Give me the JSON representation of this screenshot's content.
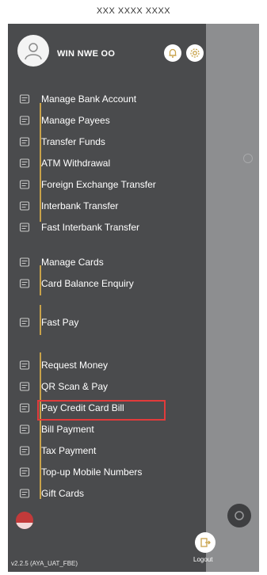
{
  "top_caption": "XXX XXXX XXXX",
  "user": {
    "name": "WIN NWE OO"
  },
  "menu": {
    "items": [
      {
        "label": "Manage Bank Account",
        "icon": "bank-icon"
      },
      {
        "label": "Manage Payees",
        "icon": "payees-icon"
      },
      {
        "label": "Transfer Funds",
        "icon": "transfer-icon"
      },
      {
        "label": "ATM Withdrawal",
        "icon": "atm-icon"
      },
      {
        "label": "Foreign Exchange Transfer",
        "icon": "transfer-icon"
      },
      {
        "label": "Interbank Transfer",
        "icon": "transfer-icon"
      },
      {
        "label": "Fast Interbank Transfer",
        "icon": "transfer-icon"
      },
      {
        "label": "Manage Cards",
        "icon": "card-icon"
      },
      {
        "label": "Card Balance Enquiry",
        "icon": "card-icon"
      },
      {
        "label": "Fast Pay",
        "icon": "fast-pay-icon"
      },
      {
        "label": "Request Money",
        "icon": "request-money-icon"
      },
      {
        "label": "QR Scan & Pay",
        "icon": "qr-icon"
      },
      {
        "label": "Pay Credit Card Bill",
        "icon": "bill-icon"
      },
      {
        "label": "Bill Payment",
        "icon": "bill-icon"
      },
      {
        "label": "Tax Payment",
        "icon": "tax-icon"
      },
      {
        "label": "Top-up Mobile Numbers",
        "icon": "topup-icon"
      },
      {
        "label": "Gift Cards",
        "icon": "gift-icon"
      }
    ]
  },
  "version": "v2.2.5 (AYA_UAT_FBE)",
  "logout_label": "Logout",
  "colors": {
    "drawer": "#4a4b4d",
    "accent": "#c8a24a",
    "highlight": "#e23b3b"
  }
}
